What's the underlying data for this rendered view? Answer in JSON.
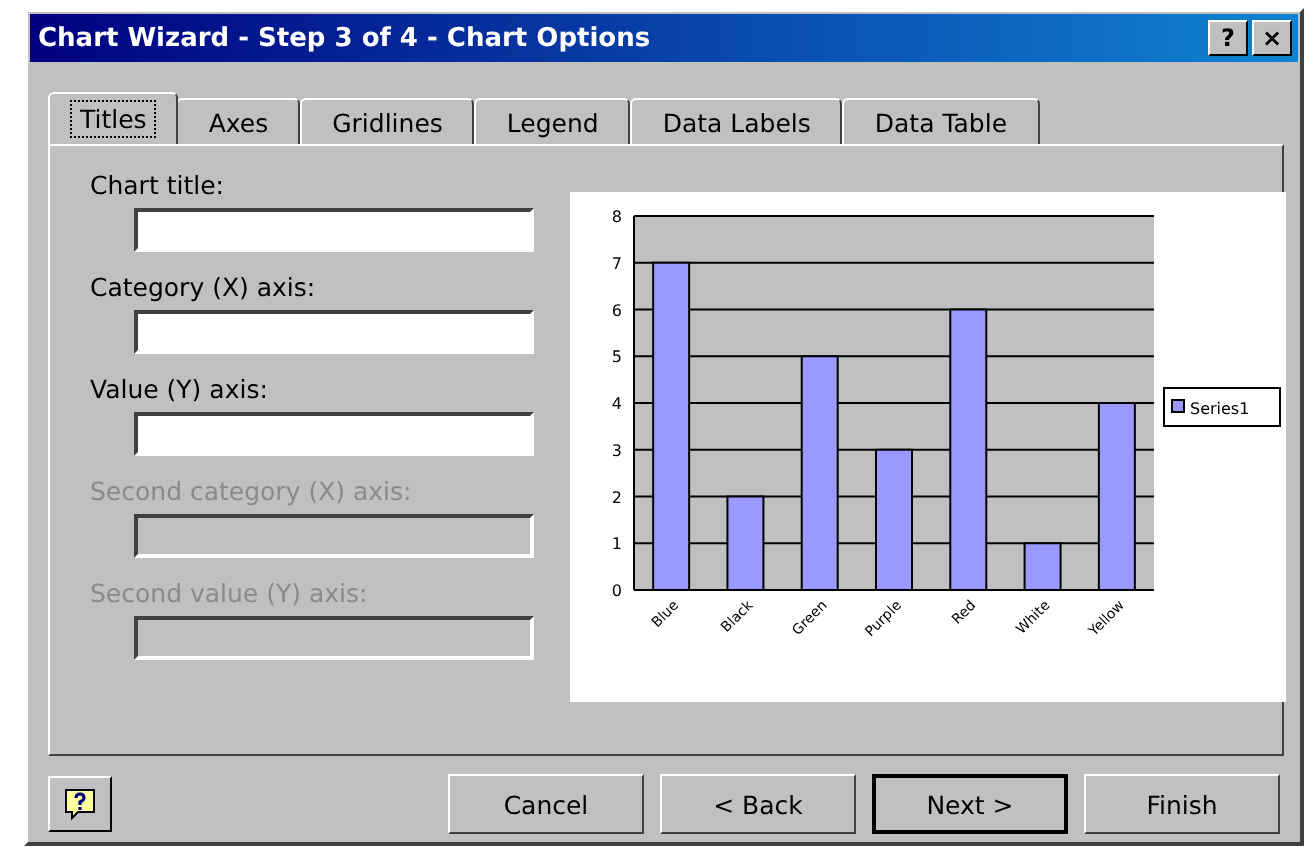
{
  "window": {
    "title": "Chart Wizard - Step 3 of 4 - Chart Options",
    "title_buttons": [
      "?",
      "×"
    ]
  },
  "tabs": [
    {
      "label": "Titles",
      "selected": true
    },
    {
      "label": "Axes",
      "selected": false
    },
    {
      "label": "Gridlines",
      "selected": false
    },
    {
      "label": "Legend",
      "selected": false
    },
    {
      "label": "Data Labels",
      "selected": false
    },
    {
      "label": "Data Table",
      "selected": false
    }
  ],
  "fields": [
    {
      "label": "Chart title:",
      "disabled": false
    },
    {
      "label": "Category (X) axis:",
      "disabled": false
    },
    {
      "label": "Value (Y) axis:",
      "disabled": false
    },
    {
      "label": "Second category (X) axis:",
      "disabled": true
    },
    {
      "label": "Second value (Y) axis:",
      "disabled": true
    }
  ],
  "preview": {
    "chart_data": {
      "type": "bar",
      "categories": [
        "Blue",
        "Black",
        "Green",
        "Purple",
        "Red",
        "White",
        "Yellow"
      ],
      "series": [
        {
          "name": "Series1",
          "color": "#9999ff",
          "values": [
            7,
            2,
            5,
            3,
            6,
            1,
            4
          ]
        }
      ],
      "ylim": [
        0,
        8
      ],
      "grid": true,
      "yticks": [
        0,
        1,
        2,
        3,
        4,
        5,
        6,
        7,
        8
      ]
    }
  },
  "buttons": [
    {
      "label": "Cancel",
      "default": false
    },
    {
      "label": "< Back",
      "default": false
    },
    {
      "label": "Next >",
      "default": true
    },
    {
      "label": "Finish",
      "default": false
    }
  ]
}
